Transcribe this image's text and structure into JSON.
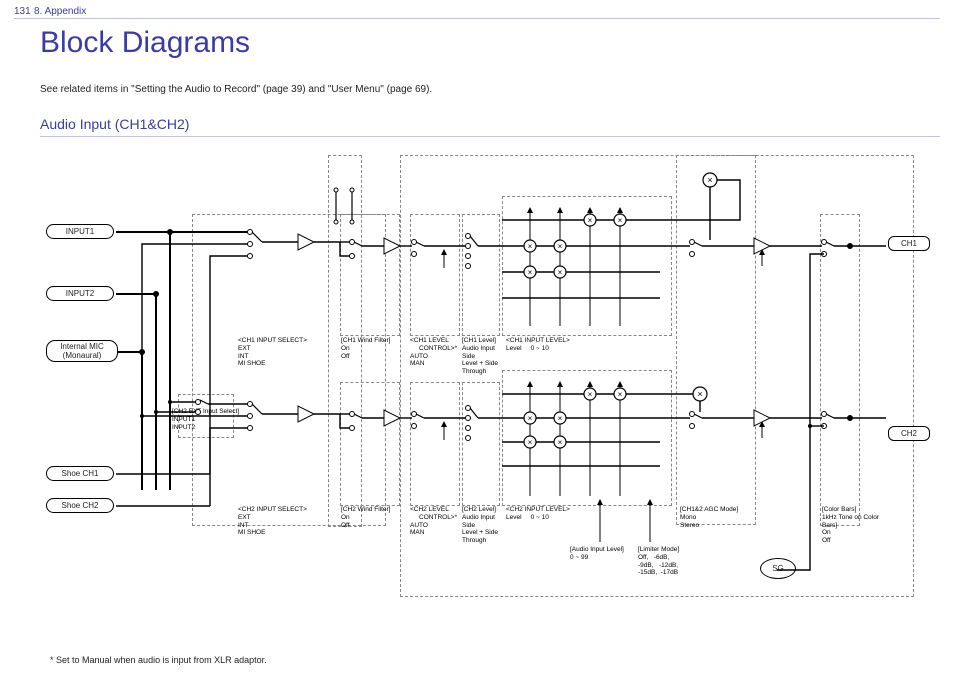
{
  "page_number": "131",
  "appendix": "8. Appendix",
  "title": "Block Diagrams",
  "see_text": "See related items in \"Setting the Audio to Record\" (page 39) and \"User Menu\" (page 69).",
  "subtitle": "Audio Input (CH1&CH2)",
  "inputs": {
    "in1": "INPUT1",
    "in2": "INPUT2",
    "mic_a": "Internal MIC",
    "mic_b": "(Monaural)",
    "shoe1": "Shoe CH1",
    "shoe2": "Shoe CH2"
  },
  "outputs": {
    "ch1": "CH1",
    "ch2": "CH2",
    "sg": "SG"
  },
  "labels": {
    "ch1_input_select": "<CH1 INPUT SELECT>\nEXT\nINT\nMI SHOE",
    "ch2_ext1": "[CH2 EXT Input Select]\nINPUT1\nINPUT2",
    "ch2_input_select": "<CH2 INPUT SELECT>\nEXT\nINT\nMI SHOE",
    "ch1_wind": "[CH1 Wind Filter]\nOn\nOff",
    "ch2_wind": "[CH2 Wind Filter]\nOn\nOff",
    "ch1_level_ctrl": "<CH1 LEVEL\n     CONTROL>*\nAUTO\nMAN",
    "ch2_level_ctrl": "<CH2 LEVEL\n     CONTROL>*\nAUTO\nMAN",
    "ch1_level": "[CH1 Level]\nAudio Input\nSide\nLevel + Side\nThrough",
    "ch2_level": "[CH2 Level]\nAudio Input\nSide\nLevel + Side\nThrough",
    "ch1_input_level_0_10": "<CH1 INPUT LEVEL>\nLevel     0 ~ 10",
    "ch2_input_level_0_10": "<CH2 INPUT LEVEL>\nLevel     0 ~ 10",
    "audio_input_level": "[Audio Input Level]\n0 ~ 99",
    "limiter": "[Limiter Mode]\nOff,   -6dB,\n-9dB,   -12dB,\n-15dB,  -17dB",
    "agc": "[CH1&2 AGC Mode]\nMono\nStereo",
    "color_bars": "[Color Bars]\n1kHz Tone on Color\nBars]\nOn\nOff"
  },
  "footnote": "*   Set to Manual when audio is input from XLR adaptor."
}
